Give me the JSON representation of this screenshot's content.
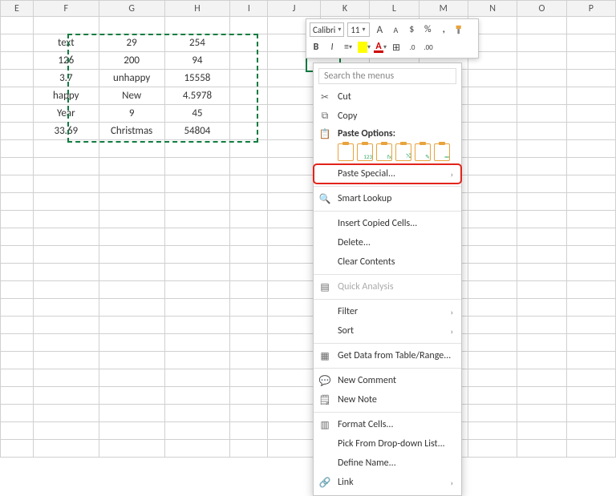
{
  "columns": [
    "E",
    "F",
    "G",
    "H",
    "I",
    "J",
    "K",
    "L",
    "M",
    "N",
    "O",
    "P"
  ],
  "table": {
    "r1": {
      "F": "text",
      "G": "29",
      "H": "254"
    },
    "r2": {
      "F": "126",
      "G": "200",
      "H": "94"
    },
    "r3": {
      "F": "3.7",
      "G": "unhappy",
      "H": "15558"
    },
    "r4": {
      "F": "happy",
      "G": "New",
      "H": "4.5978"
    },
    "r5": {
      "F": "Year",
      "G": "9",
      "H": "45"
    },
    "r6": {
      "F": "33.69",
      "G": "Christmas",
      "H": "54804"
    }
  },
  "mini": {
    "font": "Calibri",
    "size": "11",
    "inc": "A",
    "dec": "A",
    "currency": "$",
    "percent": "%",
    "comma": ",",
    "bold": "B",
    "italic": "I",
    "fontcolor": "A",
    "border": "⊞",
    "decinc": ".0",
    "decdec": ".00",
    "fmt": "✎"
  },
  "ctx": {
    "search": "Search the menus",
    "cut": "Cut",
    "copy": "Copy",
    "paste_options": "Paste Options:",
    "paste_special": "Paste Special...",
    "smart_lookup": "Smart Lookup",
    "insert": "Insert Copied Cells...",
    "delete": "Delete...",
    "clear": "Clear Contents",
    "quick": "Quick Analysis",
    "filter": "Filter",
    "sort": "Sort",
    "getdata": "Get Data from Table/Range...",
    "comment": "New Comment",
    "note": "New Note",
    "format": "Format Cells...",
    "pick": "Pick From Drop-down List...",
    "define": "Define Name...",
    "link": "Link"
  }
}
